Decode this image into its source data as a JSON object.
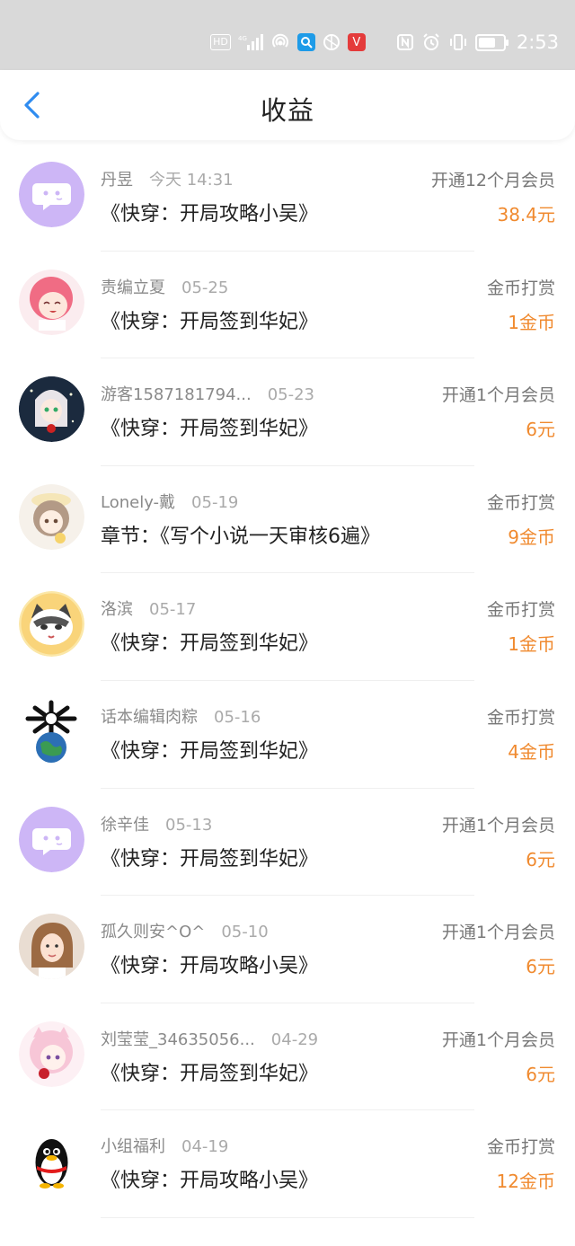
{
  "status_bar": {
    "hd": "HD",
    "network": "4G",
    "time": "2:53",
    "battery_level": 0.7
  },
  "header": {
    "title": "收益"
  },
  "colors": {
    "accent_orange": "#f08a2f",
    "back_blue": "#2f8cf0",
    "chat_purple": "#cdb6f6"
  },
  "items": [
    {
      "name": "丹昱",
      "date": "今天 14:31",
      "book": "《快穿：开局攻略小吴》",
      "type": "开通12个月会员",
      "amount": "38.4元",
      "avatar": "chat-bubble-avatar"
    },
    {
      "name": "责编立夏",
      "date": "05-25",
      "book": "《快穿：开局签到华妃》",
      "type": "金币打赏",
      "amount": "1金币",
      "avatar": "anime-girl-pink-avatar"
    },
    {
      "name": "游客1587181794...",
      "date": "05-23",
      "book": "《快穿：开局签到华妃》",
      "type": "开通1个月会员",
      "amount": "6元",
      "avatar": "anime-girl-dark-avatar"
    },
    {
      "name": "Lonely-戴",
      "date": "05-19",
      "book": "章节：《写个小说一天审核6遍》",
      "type": "金币打赏",
      "amount": "9金币",
      "avatar": "anime-girl-hat-avatar"
    },
    {
      "name": "洛滨",
      "date": "05-17",
      "book": "《快穿：开局签到华妃》",
      "type": "金币打赏",
      "amount": "1金币",
      "avatar": "cat-avatar"
    },
    {
      "name": "话本编辑肉粽",
      "date": "05-16",
      "book": "《快穿：开局签到华妃》",
      "type": "金币打赏",
      "amount": "4金币",
      "avatar": "earth-avatar"
    },
    {
      "name": "徐辛佳",
      "date": "05-13",
      "book": "《快穿：开局签到华妃》",
      "type": "开通1个月会员",
      "amount": "6元",
      "avatar": "chat-bubble-avatar"
    },
    {
      "name": "孤久则安^O^",
      "date": "05-10",
      "book": "《快穿：开局攻略小吴》",
      "type": "开通1个月会员",
      "amount": "6元",
      "avatar": "photo-avatar"
    },
    {
      "name": "刘莹莹_34635056...",
      "date": "04-29",
      "book": "《快穿：开局签到华妃》",
      "type": "开通1个月会员",
      "amount": "6元",
      "avatar": "anime-girl-flower-avatar"
    },
    {
      "name": "小组福利",
      "date": "04-19",
      "book": "《快穿：开局攻略小吴》",
      "type": "金币打赏",
      "amount": "12金币",
      "avatar": "penguin-avatar"
    }
  ]
}
